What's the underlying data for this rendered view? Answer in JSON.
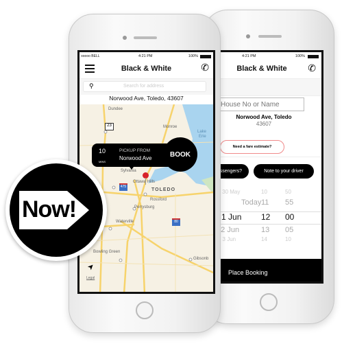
{
  "back_phone": {
    "status": {
      "time": "4:21 PM",
      "battery": "100%"
    },
    "title": "Black & White",
    "icons": {
      "phone": "phone-icon"
    },
    "house_input_placeholder": "House No or Name",
    "address_line1": "Norwood Ave, Toledo",
    "address_line2": "43607",
    "fare_button": "Need a fare estimate?",
    "passengers_button": "passengers?",
    "note_button": "Note to your driver",
    "picker": {
      "days": [
        "on 30 May",
        "Today",
        "d 1 Jun",
        "u 2 Jun",
        "Fri 3 Jun"
      ],
      "hours": [
        "10",
        "11",
        "12",
        "13",
        "14"
      ],
      "minutes": [
        "50",
        "55",
        "00",
        "05",
        "10"
      ],
      "selected_index": 2
    },
    "place_booking": "Place Booking"
  },
  "front_phone": {
    "status": {
      "carrier": "ooooo BELL",
      "time": "4:21 PM",
      "battery": "100%"
    },
    "title": "Black & White",
    "icons": {
      "menu": "hamburger-icon",
      "phone": "phone-icon",
      "search": "search-icon",
      "location": "location-arrow-icon"
    },
    "search_placeholder": "Search for address",
    "address": "Norwood Ave, Toledo, 43607",
    "pickup": {
      "mins": "10",
      "mins_label": "MINS",
      "label": "PICKUP FROM",
      "place": "Norwood Ave",
      "book": "BOOK"
    },
    "map_labels": {
      "dundee": "Dundee",
      "monroe": "Monroe",
      "lake": "Lake",
      "erie": "Erie",
      "sylvania": "Sylvania",
      "ottawa_hills": "Ottawa Hills",
      "toledo": "TOLEDO",
      "rossford": "Rossford",
      "perrysburg": "Perrysburg",
      "waterville": "Waterville",
      "bowling_green": "Bowling Green",
      "gibsonburg": "Gibsonb",
      "route23": "23",
      "i475": "475",
      "i80": "80",
      "legal": "Legal"
    }
  },
  "badge": {
    "text": "Now!"
  }
}
